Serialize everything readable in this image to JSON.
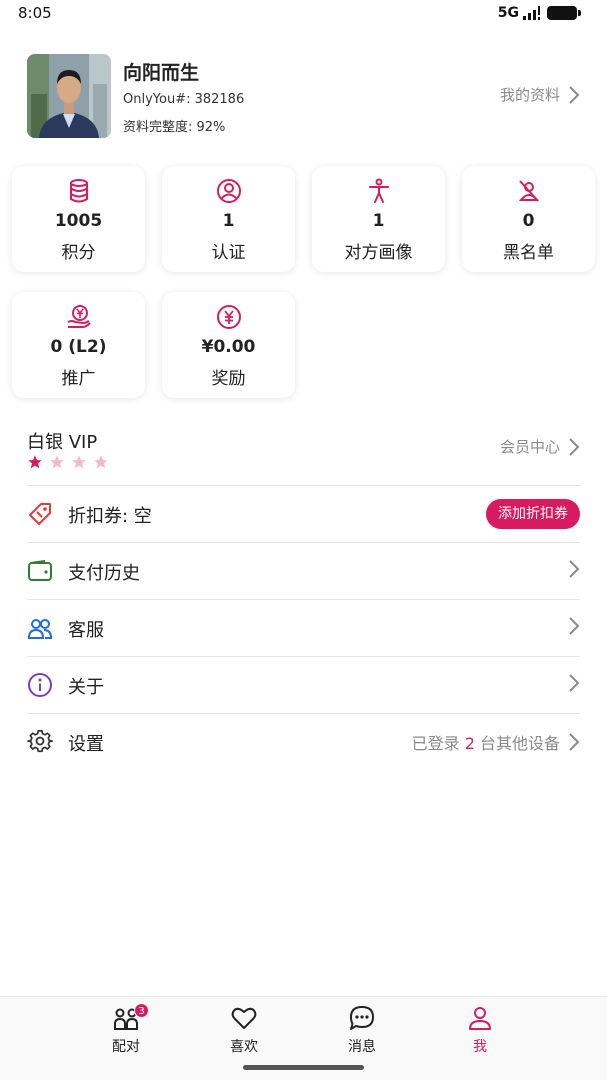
{
  "status_bar": {
    "time": "8:05",
    "network": "5G",
    "signal_icon": "signal-icon",
    "battery_icon": "battery-icon"
  },
  "profile": {
    "name": "向阳而生",
    "id_text": "OnlyYou#: 382186",
    "completeness_text": "资料完整度: 92%",
    "link_label": "我的资料",
    "avatar_icon": "user-photo"
  },
  "stats": [
    {
      "icon": "database-icon",
      "value": "1005",
      "label": "积分"
    },
    {
      "icon": "verified-user-icon",
      "value": "1",
      "label": "认证"
    },
    {
      "icon": "person-figure-icon",
      "value": "1",
      "label": "对方画像"
    },
    {
      "icon": "blocked-user-icon",
      "value": "0",
      "label": "黑名单"
    },
    {
      "icon": "yuan-hand-icon",
      "value": "0 (L2)",
      "label": "推广"
    },
    {
      "icon": "yuan-circle-icon",
      "value": "¥0.00",
      "label": "奖励"
    }
  ],
  "vip": {
    "title": "白银 VIP",
    "stars_filled": 1,
    "stars_total": 4,
    "link_label": "会员中心"
  },
  "menu": {
    "coupon": {
      "label": "折扣券: 空",
      "button_label": "添加折扣券",
      "icon": "tag-icon"
    },
    "payment": {
      "label": "支付历史",
      "icon": "wallet-icon"
    },
    "support": {
      "label": "客服",
      "icon": "users-icon"
    },
    "about": {
      "label": "关于",
      "icon": "info-icon"
    },
    "settings": {
      "label": "设置",
      "icon": "gear-icon",
      "status_prefix": "已登录",
      "status_count": "2",
      "status_suffix": "台其他设备"
    }
  },
  "bottom_nav": [
    {
      "label": "配对",
      "icon": "match-icon",
      "badge": "3",
      "active": false
    },
    {
      "label": "喜欢",
      "icon": "heart-icon",
      "active": false
    },
    {
      "label": "消息",
      "icon": "chat-icon",
      "active": false
    },
    {
      "label": "我",
      "icon": "profile-icon",
      "active": true
    }
  ],
  "colors": {
    "accent": "#d81b60",
    "star_empty": "#f3b8cc",
    "wallet_green": "#2e7d32",
    "support_blue": "#1e6fd9",
    "about_purple": "#7b3fb0",
    "coupon_red": "#e53935"
  }
}
